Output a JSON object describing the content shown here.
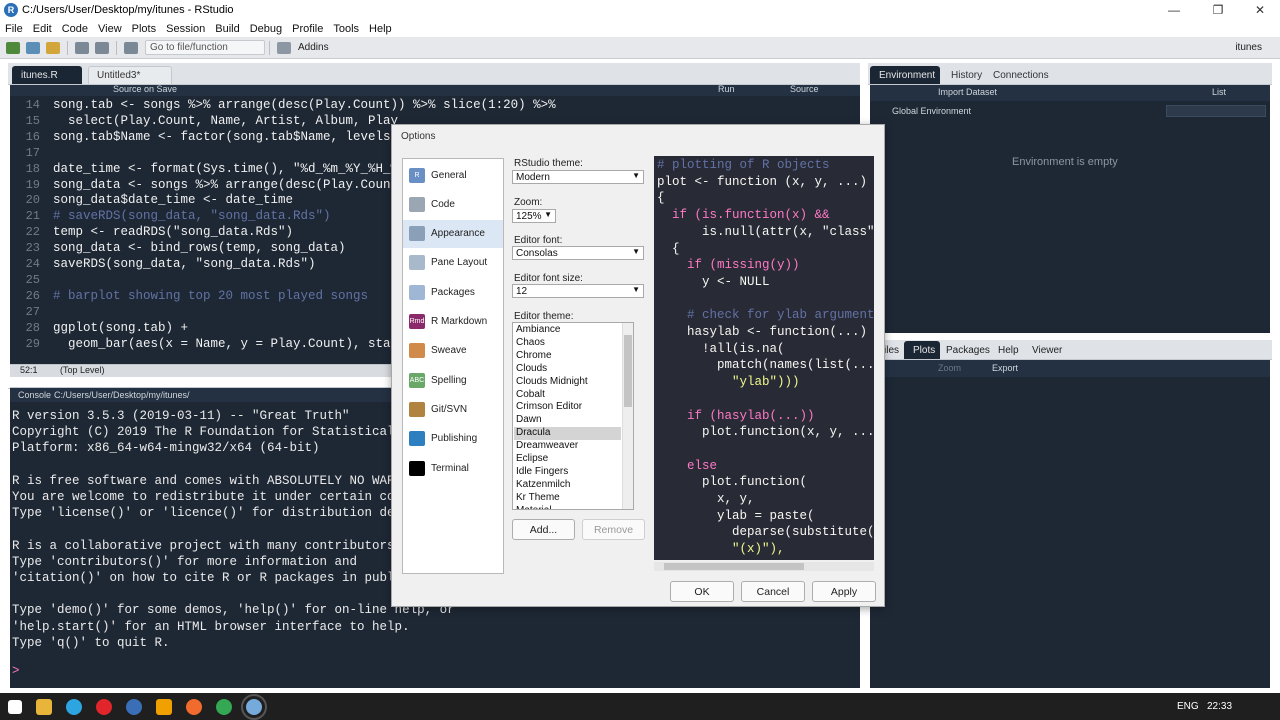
{
  "window": {
    "title": "C:/Users/User/Desktop/my/itunes - RStudio",
    "r_logo": "R"
  },
  "menu": [
    "File",
    "Edit",
    "Code",
    "View",
    "Plots",
    "Session",
    "Build",
    "Debug",
    "Profile",
    "Tools",
    "Help"
  ],
  "toolbar": {
    "goto_file": "Go to file/function",
    "addins": "Addins",
    "project": "itunes"
  },
  "editor": {
    "tabs": [
      "itunes.R",
      "Untitled3*"
    ],
    "source_on_save": "Source on Save",
    "run": "Run",
    "source": "Source",
    "lines": [
      {
        "n": "14",
        "t": "song.tab <- songs %>% arrange(desc(Play.Count)) %>% slice(1:20) %>%"
      },
      {
        "n": "15",
        "t": "  select(Play.Count, Name, Artist, Album, Play"
      },
      {
        "n": "16",
        "t": "song.tab$Name <- factor(song.tab$Name, levels"
      },
      {
        "n": "17",
        "t": ""
      },
      {
        "n": "18",
        "t": "date_time <- format(Sys.time(), \"%d_%m_%Y_%H_%"
      },
      {
        "n": "19",
        "t": "song_data <- songs %>% arrange(desc(Play.Count"
      },
      {
        "n": "20",
        "t": "song_data$date_time <- date_time"
      },
      {
        "n": "21",
        "t": "# saveRDS(song_data, \"song_data.Rds\")"
      },
      {
        "n": "22",
        "t": "temp <- readRDS(\"song_data.Rds\")"
      },
      {
        "n": "23",
        "t": "song_data <- bind_rows(temp, song_data)"
      },
      {
        "n": "24",
        "t": "saveRDS(song_data, \"song_data.Rds\")"
      },
      {
        "n": "25",
        "t": ""
      },
      {
        "n": "26",
        "t": "# barplot showing top 20 most played songs"
      },
      {
        "n": "27",
        "t": ""
      },
      {
        "n": "28",
        "t": "ggplot(song.tab) +"
      },
      {
        "n": "29",
        "t": "  geom_bar(aes(x = Name, y = Play.Count), stat"
      }
    ],
    "status_pos": "52:1",
    "status_scope": "(Top Level)"
  },
  "console": {
    "label": "Console",
    "path": "C:/Users/User/Desktop/my/itunes/",
    "lines": [
      "R version 3.5.3 (2019-03-11) -- \"Great Truth\"",
      "Copyright (C) 2019 The R Foundation for Statistical",
      "Platform: x86_64-w64-mingw32/x64 (64-bit)",
      "",
      "R is free software and comes with ABSOLUTELY NO WARR",
      "You are welcome to redistribute it under certain con",
      "Type 'license()' or 'licence()' for distribution det",
      "",
      "R is a collaborative project with many contributors.",
      "Type 'contributors()' for more information and",
      "'citation()' on how to cite R or R packages in publi",
      "",
      "Type 'demo()' for some demos, 'help()' for on-line help, or",
      "'help.start()' for an HTML browser interface to help.",
      "Type 'q()' to quit R."
    ],
    "prompt": ">"
  },
  "env_pane": {
    "tabs": [
      "Environment",
      "History",
      "Connections"
    ],
    "import_dataset": "Import Dataset",
    "list_view": "List",
    "scope": "Global Environment",
    "empty_msg": "Environment is empty"
  },
  "files_pane": {
    "tabs": [
      "iles",
      "Plots",
      "Packages",
      "Help",
      "Viewer"
    ],
    "zoom": "Zoom",
    "export": "Export"
  },
  "dialog": {
    "title": "Options",
    "nav": [
      {
        "label": "General",
        "icon": "r-icon",
        "color": "#6a8fc4",
        "glyph": "R"
      },
      {
        "label": "Code",
        "icon": "code-icon",
        "color": "#9aa6b2",
        "glyph": ""
      },
      {
        "label": "Appearance",
        "icon": "appearance-icon",
        "color": "#8aa0b8",
        "glyph": ""
      },
      {
        "label": "Pane Layout",
        "icon": "pane-layout-icon",
        "color": "#a9b9cc",
        "glyph": ""
      },
      {
        "label": "Packages",
        "icon": "packages-icon",
        "color": "#9fb7d4",
        "glyph": ""
      },
      {
        "label": "R Markdown",
        "icon": "rmarkdown-icon",
        "color": "#8b2a6a",
        "glyph": "Rmd"
      },
      {
        "label": "Sweave",
        "icon": "sweave-icon",
        "color": "#d08b4b",
        "glyph": ""
      },
      {
        "label": "Spelling",
        "icon": "spelling-icon",
        "color": "#6aa86a",
        "glyph": "ABC"
      },
      {
        "label": "Git/SVN",
        "icon": "git-icon",
        "color": "#b0833f",
        "glyph": ""
      },
      {
        "label": "Publishing",
        "icon": "publishing-icon",
        "color": "#2e7fc0",
        "glyph": ""
      },
      {
        "label": "Terminal",
        "icon": "terminal-icon",
        "color": "#000000",
        "glyph": ""
      }
    ],
    "selected_nav": "Appearance",
    "rstudio_theme_label": "RStudio theme:",
    "rstudio_theme_value": "Modern",
    "zoom_label": "Zoom:",
    "zoom_value": "125%",
    "editor_font_label": "Editor font:",
    "editor_font_value": "Consolas",
    "font_size_label": "Editor font size:",
    "font_size_value": "12",
    "editor_theme_label": "Editor theme:",
    "themes": [
      "Ambiance",
      "Chaos",
      "Chrome",
      "Clouds",
      "Clouds Midnight",
      "Cobalt",
      "Crimson Editor",
      "Dawn",
      "Dracula",
      "Dreamweaver",
      "Eclipse",
      "Idle Fingers",
      "Katzenmilch",
      "Kr Theme",
      "Material"
    ],
    "selected_theme": "Dracula",
    "add_button": "Add...",
    "remove_button": "Remove",
    "ok_button": "OK",
    "cancel_button": "Cancel",
    "apply_button": "Apply",
    "preview_lines": [
      "# plotting of R objects",
      "plot <- function (x, y, ...)",
      "{",
      "  if (is.function(x) &&",
      "      is.null(attr(x, \"class\")",
      "  {",
      "    if (missing(y))",
      "      y <- NULL",
      "",
      "    # check for ylab argument",
      "    hasylab <- function(...)",
      "      !all(is.na(",
      "        pmatch(names(list(...)",
      "          \"ylab\")))",
      "",
      "    if (hasylab(...))",
      "      plot.function(x, y, ...)",
      "",
      "    else",
      "      plot.function(",
      "        x, y,",
      "        ylab = paste(",
      "          deparse(substitute(x",
      "          \"(x)\"),"
    ]
  },
  "taskbar": {
    "lang": "ENG",
    "time": "22:33"
  }
}
